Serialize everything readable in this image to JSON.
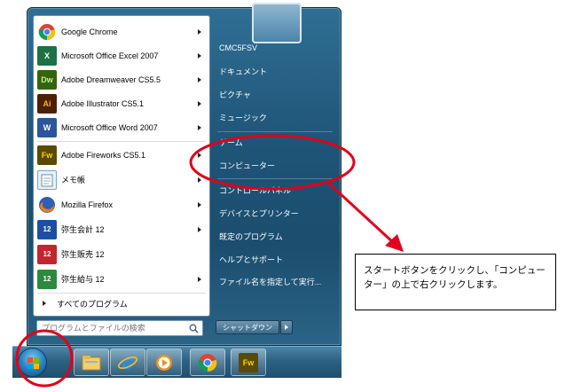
{
  "programs": [
    {
      "label": "Google Chrome",
      "icon": "chrome-icon",
      "has_submenu": true
    },
    {
      "label": "Microsoft Office Excel 2007",
      "icon": "excel-icon",
      "has_submenu": true
    },
    {
      "label": "Adobe Dreamweaver CS5.5",
      "icon": "dreamweaver-icon",
      "has_submenu": true
    },
    {
      "label": "Adobe Illustrator CS5.1",
      "icon": "illustrator-icon",
      "has_submenu": true
    },
    {
      "label": "Microsoft Office Word 2007",
      "icon": "word-icon",
      "has_submenu": true
    },
    {
      "label": "Adobe Fireworks CS5.1",
      "icon": "fireworks-icon",
      "has_submenu": true
    },
    {
      "label": "メモ帳",
      "icon": "notepad-icon",
      "has_submenu": true
    },
    {
      "label": "Mozilla Firefox",
      "icon": "firefox-icon",
      "has_submenu": true
    },
    {
      "label": "弥生会計 12",
      "icon": "yayoi-kaikei-icon",
      "has_submenu": true
    },
    {
      "label": "弥生販売 12",
      "icon": "yayoi-hanbai-icon",
      "has_submenu": false
    },
    {
      "label": "弥生給与 12",
      "icon": "yayoi-kyuyo-icon",
      "has_submenu": true
    }
  ],
  "icon_text": {
    "dw": "Dw",
    "ai": "Ai",
    "fw": "Fw",
    "x": "X",
    "w": "W",
    "yayoi": "12"
  },
  "all_programs_label": "すべてのプログラム",
  "search_placeholder": "プログラムとファイルの検索",
  "right_items": [
    {
      "label": "CMC5FSV"
    },
    {
      "label": "ドキュメント"
    },
    {
      "label": "ピクチャ"
    },
    {
      "label": "ミュージック"
    },
    {
      "label": "ゲーム"
    },
    {
      "label": "コンピューター"
    },
    {
      "label": "コントロールパネル"
    },
    {
      "label": "デバイスとプリンター"
    },
    {
      "label": "既定のプログラム"
    },
    {
      "label": "ヘルプとサポート"
    },
    {
      "label": "ファイル名を指定して実行..."
    }
  ],
  "shutdown_label": "シャットダウン",
  "taskbar_items": [
    {
      "name": "explorer-icon"
    },
    {
      "name": "internet-explorer-icon"
    },
    {
      "name": "media-player-icon"
    },
    {
      "name": "chrome-icon"
    },
    {
      "name": "fireworks-icon"
    }
  ],
  "callout_text": "スタートボタンをクリックし、「コンピューター」の上で右クリックします。",
  "colors": {
    "annotation_red": "#e2001a",
    "menu_blue": "#1f5578"
  }
}
